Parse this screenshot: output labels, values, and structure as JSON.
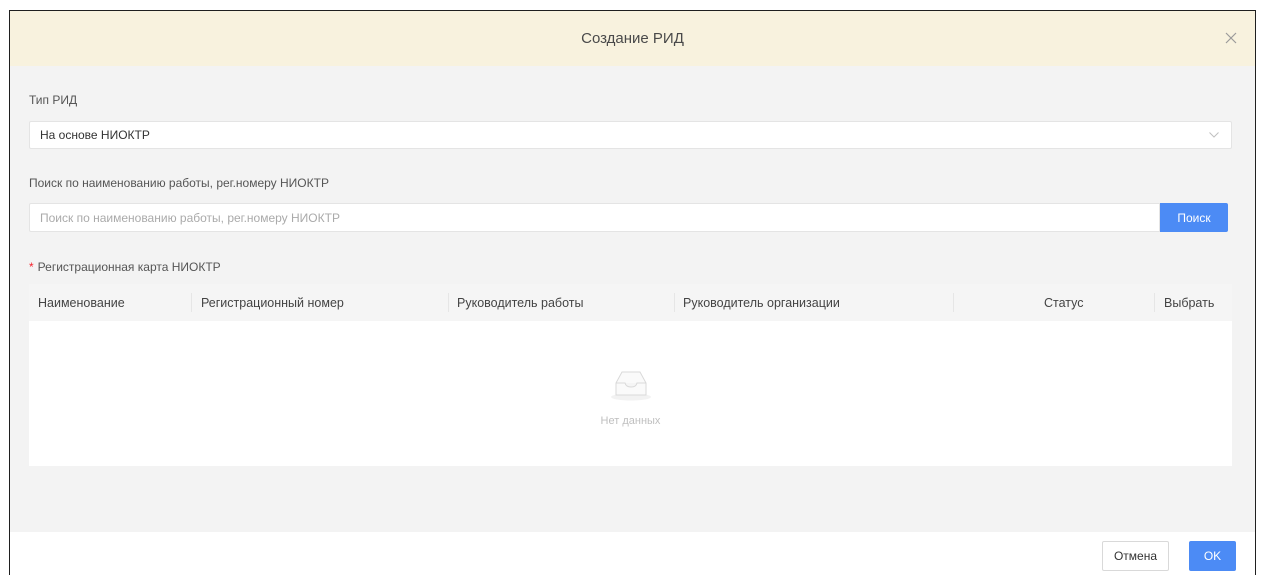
{
  "dialog": {
    "title": "Создание РИД",
    "close_icon": "close-icon"
  },
  "rid_type": {
    "label": "Тип РИД",
    "value": "На основе НИОКТР",
    "icon": "chevron-down-icon"
  },
  "search": {
    "label": "Поиск по наименованию работы, рег.номеру НИОКТР",
    "placeholder": "Поиск по наименованию работы, рег.номеру НИОКТР",
    "button_label": "Поиск"
  },
  "registration_card": {
    "required_mark": "*",
    "label": "Регистрационная карта НИОКТР",
    "columns": [
      "Наименование",
      "Регистрационный номер",
      "Руководитель работы",
      "Руководитель организации",
      "Статус",
      "Выбрать"
    ],
    "rows": [],
    "empty_text": "Нет данных",
    "empty_icon": "empty-inbox-icon"
  },
  "footer": {
    "cancel_label": "Отмена",
    "ok_label": "OK"
  },
  "colors": {
    "header_bg": "#f8f2de",
    "primary": "#4c8bf5",
    "required": "#f5222d"
  }
}
